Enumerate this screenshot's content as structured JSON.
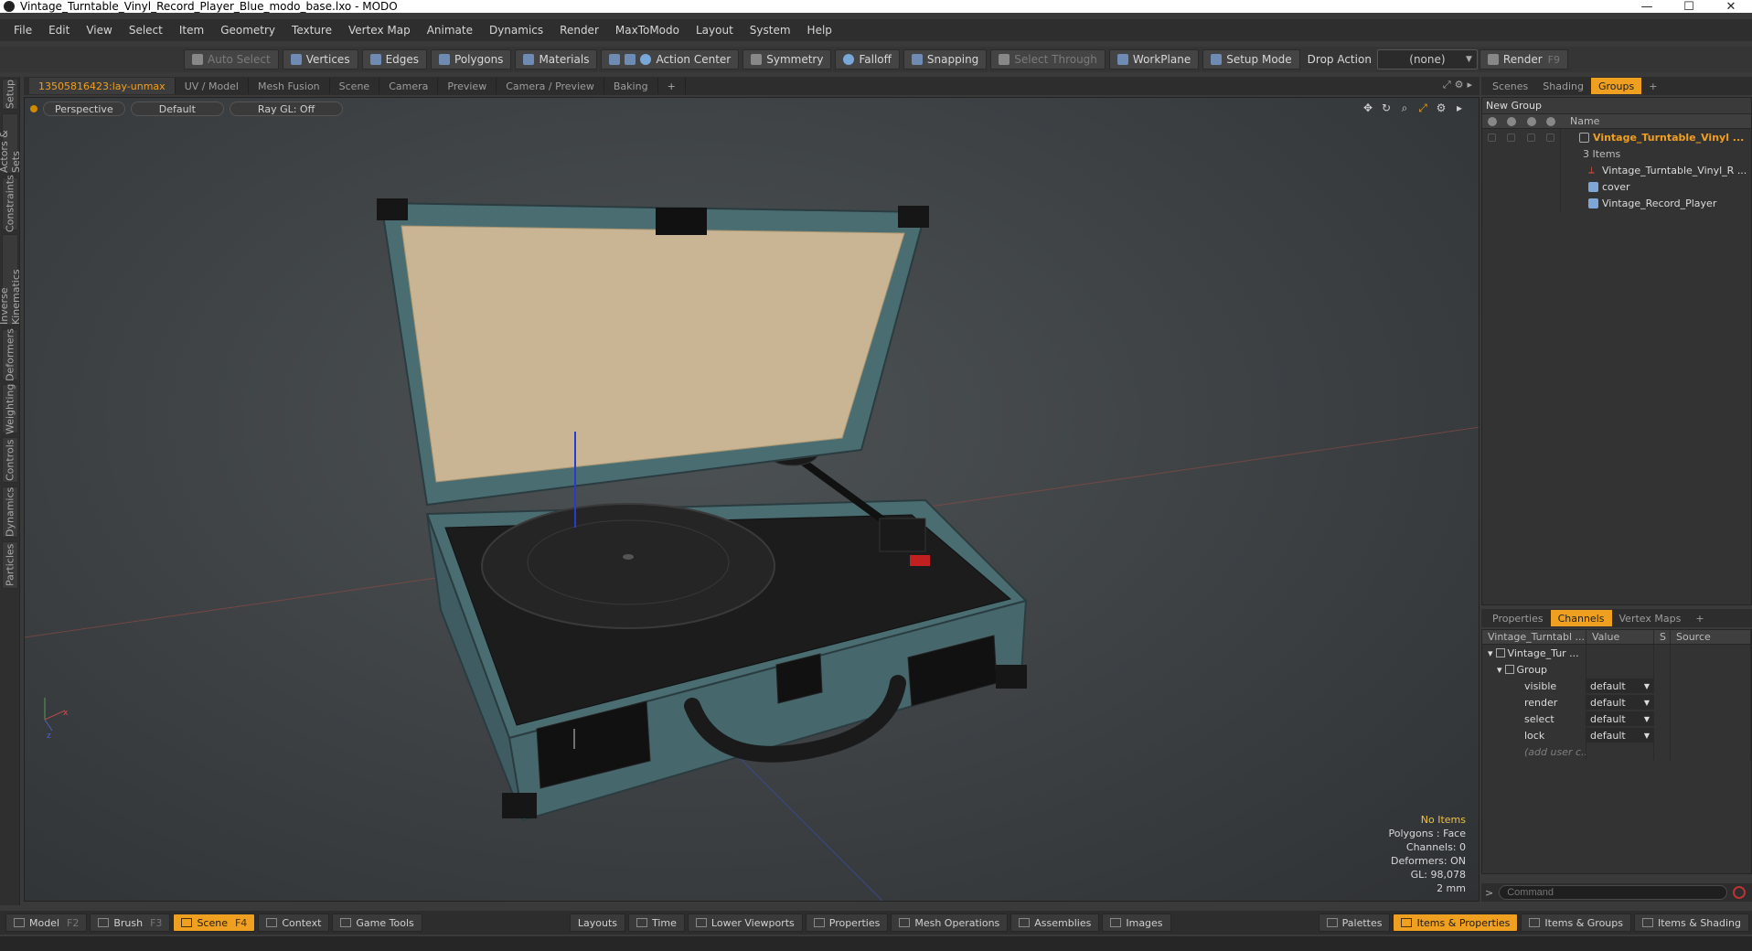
{
  "window": {
    "title": "Vintage_Turntable_Vinyl_Record_Player_Blue_modo_base.lxo - MODO",
    "min": "—",
    "max": "☐",
    "close": "✕"
  },
  "menu": [
    "File",
    "Edit",
    "View",
    "Select",
    "Item",
    "Geometry",
    "Texture",
    "Vertex Map",
    "Animate",
    "Dynamics",
    "Render",
    "MaxToModo",
    "Layout",
    "System",
    "Help"
  ],
  "toolbar": {
    "auto_select": "Auto Select",
    "vertices": "Vertices",
    "edges": "Edges",
    "polygons": "Polygons",
    "materials": "Materials",
    "action_center": "Action Center",
    "symmetry": "Symmetry",
    "falloff": "Falloff",
    "snapping": "Snapping",
    "select_through": "Select Through",
    "workplane": "WorkPlane",
    "setup_mode": "Setup Mode",
    "drop_action_label": "Drop Action",
    "drop_action_value": "(none)",
    "render": "Render",
    "render_key": "F9"
  },
  "left_tabs": [
    "Setup",
    "Actors & Sets",
    "Constraints",
    "Inverse Kinematics",
    "Deformers",
    "Weighting",
    "Controls",
    "Dynamics",
    "Particles"
  ],
  "viewport_tabs": [
    "13505816423:lay-unmax",
    "UV / Model",
    "Mesh Fusion",
    "Scene",
    "Camera",
    "Preview",
    "Camera / Preview",
    "Baking",
    "+"
  ],
  "viewport": {
    "view_mode": "Perspective",
    "shading": "Default",
    "raygl": "Ray GL: Off",
    "stats": {
      "items": "No Items",
      "polygons": "Polygons : Face",
      "channels": "Channels: 0",
      "deformers": "Deformers: ON",
      "gl": "GL: 98,078",
      "scale": "2 mm"
    }
  },
  "scene_tabs": [
    "Scenes",
    "Shading",
    "Groups",
    "+"
  ],
  "scene_panel": {
    "new_group": "New Group",
    "name_col": "Name",
    "items": [
      {
        "name": "Vintage_Turntable_Vinyl ...",
        "sub": "3 Items"
      },
      {
        "name": "Vintage_Turntable_Vinyl_R ..."
      },
      {
        "name": "cover"
      },
      {
        "name": "Vintage_Record_Player"
      }
    ]
  },
  "props_tabs": [
    "Properties",
    "Channels",
    "Vertex Maps",
    "+"
  ],
  "channels": {
    "header": {
      "name": "Vintage_Turntabl ...",
      "value": "Value",
      "s": "S",
      "source": "Source"
    },
    "root": "Vintage_Tur ...",
    "group": "Group",
    "rows": [
      {
        "name": "visible",
        "value": "default"
      },
      {
        "name": "render",
        "value": "default"
      },
      {
        "name": "select",
        "value": "default"
      },
      {
        "name": "lock",
        "value": "default"
      }
    ],
    "add_user": "(add user c..."
  },
  "command": {
    "prompt": ">",
    "placeholder": "Command"
  },
  "bottom": {
    "left": [
      {
        "label": "Model",
        "key": "F2"
      },
      {
        "label": "Brush",
        "key": "F3"
      },
      {
        "label": "Scene",
        "key": "F4"
      },
      {
        "label": "Context",
        "key": ""
      },
      {
        "label": "Game Tools",
        "key": ""
      }
    ],
    "center": [
      "Layouts",
      "Time",
      "Lower Viewports",
      "Properties",
      "Mesh Operations",
      "Assemblies",
      "Images"
    ],
    "right": [
      "Palettes",
      "Items & Properties",
      "Items & Groups",
      "Items & Shading"
    ]
  },
  "colors": {
    "accent": "#f0a020",
    "case_blue": "#4a6d72",
    "lining": "#c9b493"
  }
}
